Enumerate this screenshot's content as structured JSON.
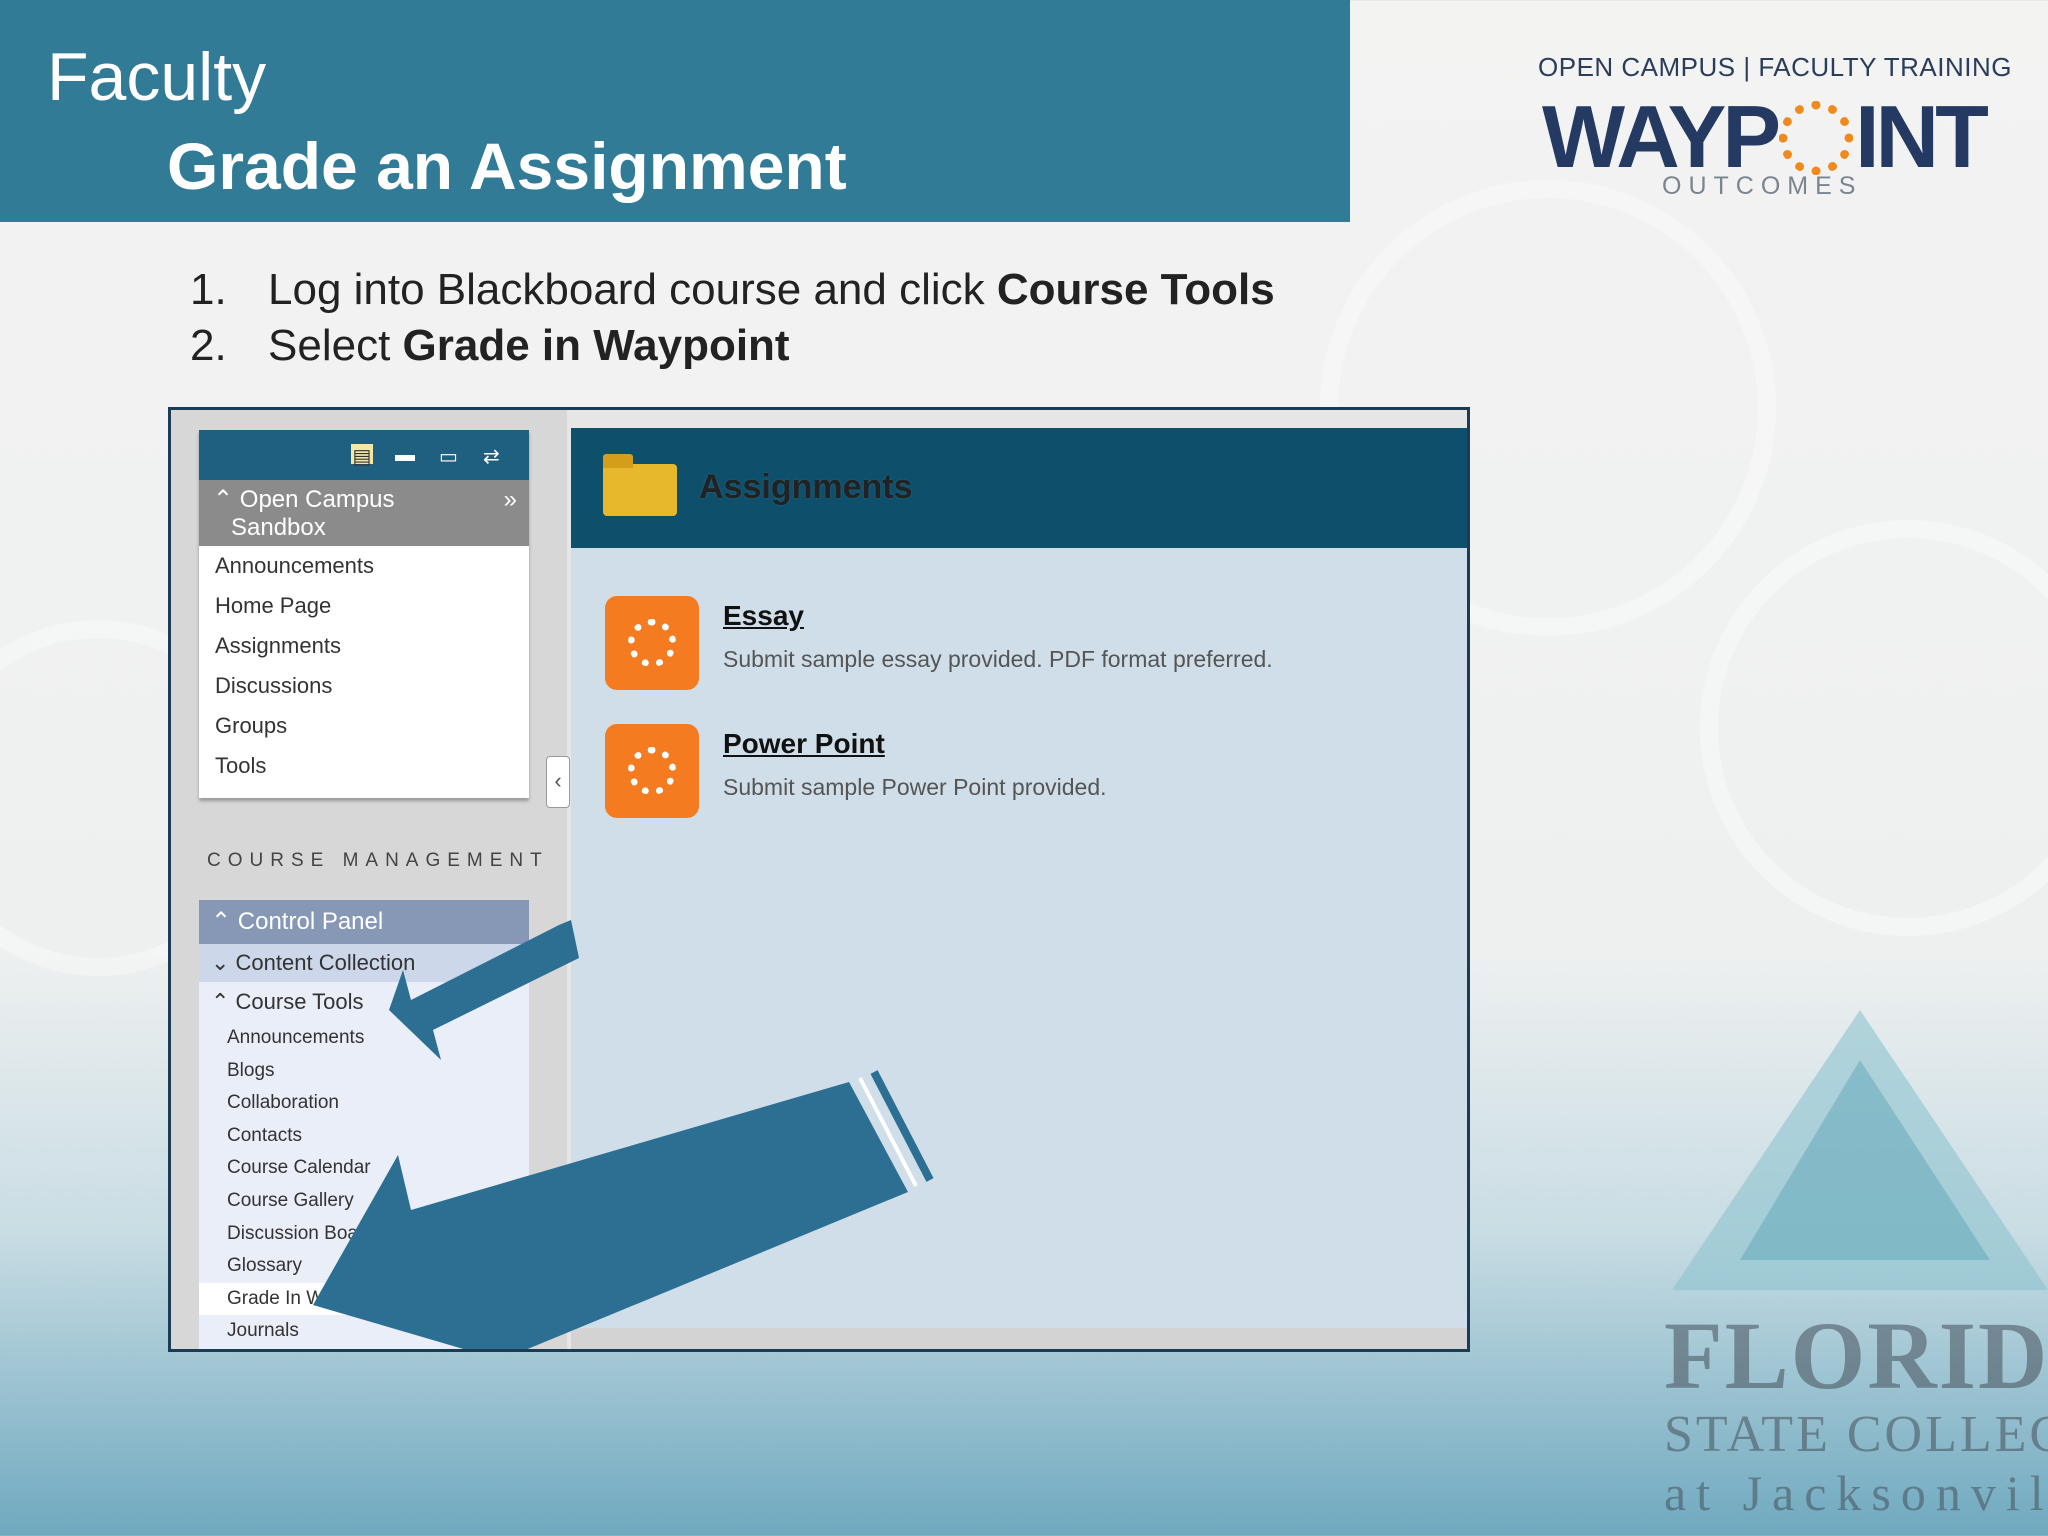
{
  "slide": {
    "header_line1": "Faculty",
    "header_line2": "Grade an Assignment",
    "brand_tagline": "OPEN CAMPUS | FACULTY TRAINING",
    "brand_logo_left": "WAYP",
    "brand_logo_right": "INT",
    "brand_sub": "OUTCOMES",
    "steps": [
      {
        "num": "1.",
        "text": "Log into Blackboard course and click ",
        "bold": "Course Tools"
      },
      {
        "num": "2.",
        "text": "Select ",
        "bold": "Grade in Waypoint"
      }
    ],
    "college_logo_line1": "FLORIDA",
    "college_logo_line2": "STATE COLLEGE",
    "college_logo_line3": "at Jacksonville"
  },
  "screenshot": {
    "course_menu": {
      "title_line1": "Open Campus",
      "title_line2": "Sandbox",
      "items": [
        "Announcements",
        "Home Page",
        "Assignments",
        "Discussions",
        "Groups",
        "Tools"
      ]
    },
    "course_management_label": "COURSE MANAGEMENT",
    "control_panel": {
      "title": "Control Panel",
      "content_collection": "Content Collection",
      "course_tools": "Course Tools",
      "tools": [
        "Announcements",
        "Blogs",
        "Collaboration",
        "Contacts",
        "Course Calendar",
        "Course Gallery",
        "Discussion Board",
        "Glossary",
        "Grade In Waypoint",
        "Journals"
      ]
    },
    "content": {
      "title": "Assignments",
      "items": [
        {
          "name": "Essay",
          "description": "Submit sample essay provided. PDF format preferred."
        },
        {
          "name": "Power Point",
          "description": "Submit sample Power Point provided."
        }
      ]
    }
  },
  "colors": {
    "header_band": "#327b97",
    "blackboard_header": "#0e4f6b",
    "assignment_icon": "#f47b20",
    "arrow": "#2c6f92"
  }
}
